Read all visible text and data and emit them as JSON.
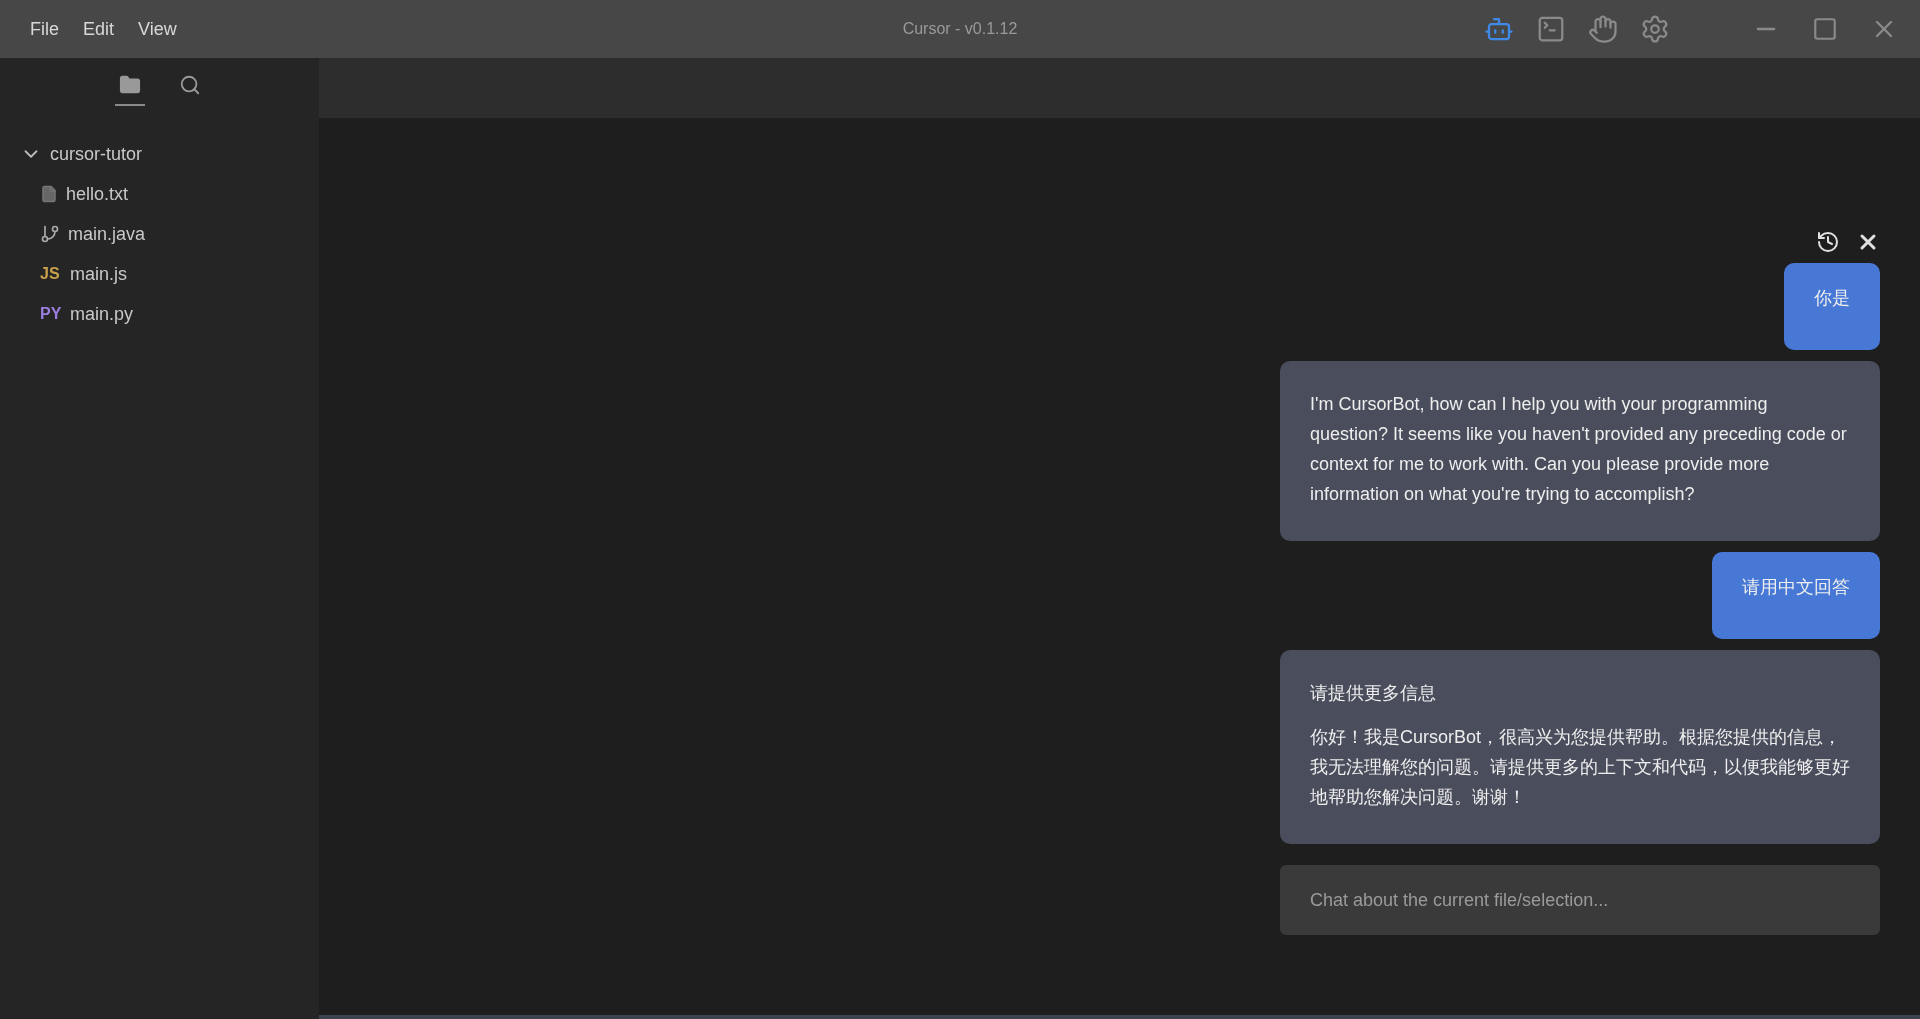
{
  "window": {
    "title": "Cursor - v0.1.12"
  },
  "menu": [
    "File",
    "Edit",
    "View"
  ],
  "toolbar": [
    {
      "kind": "bot",
      "selected": true
    },
    {
      "kind": "terminal",
      "selected": false
    },
    {
      "kind": "wave",
      "selected": false
    },
    {
      "kind": "settings",
      "selected": false
    }
  ],
  "sidebar": {
    "tabs": [
      {
        "kind": "files",
        "selected": true
      },
      {
        "kind": "search",
        "selected": false
      }
    ],
    "tree": {
      "label": "cursor-tutor",
      "expanded": true,
      "children": [
        {
          "label": "hello.txt",
          "kind": "text"
        },
        {
          "label": "main.java",
          "kind": "java"
        },
        {
          "label": "main.js",
          "kind": "js",
          "badge": "JS"
        },
        {
          "label": "main.py",
          "kind": "py",
          "badge": "PY"
        }
      ]
    }
  },
  "chat": {
    "messages": [
      {
        "kind": "user",
        "text": "你是"
      },
      {
        "kind": "bot",
        "text": "I'm CursorBot, how can I help you with your programming question? It seems like you haven't provided any preceding code or context for me to work with. Can you please provide more information on what you're trying to accomplish?"
      },
      {
        "kind": "user",
        "text": "请用中文回答"
      },
      {
        "kind": "bot",
        "heading": "请提供更多信息",
        "text": "你好！我是CursorBot，很高兴为您提供帮助。根据您提供的信息，我无法理解您的问题。请提供更多的上下文和代码，以便我能够更好地帮助您解决问题。谢谢！"
      }
    ],
    "input": {
      "placeholder": "Chat about the current file/selection..."
    }
  }
}
